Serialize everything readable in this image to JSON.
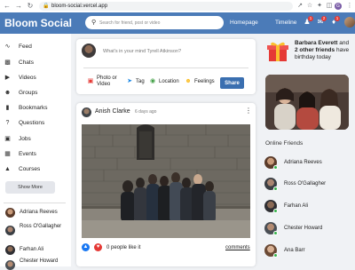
{
  "browser": {
    "url": "bloom-social.vercel.app",
    "profile_initial": "G",
    "icons": [
      "back-icon",
      "forward-icon",
      "reload-icon",
      "lock-icon",
      "share-page-icon",
      "bookmark-star-icon",
      "extensions-icon",
      "side-panel-icon",
      "browser-profile-icon",
      "browser-menu-icon"
    ]
  },
  "header": {
    "brand": "Bloom Social",
    "search_placeholder": "Search for friend, post or video",
    "nav_links": [
      "Homepage",
      "Timeline"
    ],
    "notifications": [
      {
        "icon": "person-icon",
        "count": "1"
      },
      {
        "icon": "chat-icon",
        "count": "2"
      },
      {
        "icon": "bell-icon",
        "count": "1"
      }
    ],
    "color": "#4b7bb8"
  },
  "sidebar": {
    "items": [
      {
        "icon": "rss-feed-icon",
        "label": "Feed"
      },
      {
        "icon": "chat-icon",
        "label": "Chats"
      },
      {
        "icon": "play-circle-icon",
        "label": "Videos"
      },
      {
        "icon": "group-icon",
        "label": "Groups"
      },
      {
        "icon": "bookmark-icon",
        "label": "Bookmarks"
      },
      {
        "icon": "help-circle-icon",
        "label": "Questions"
      },
      {
        "icon": "work-icon",
        "label": "Jobs"
      },
      {
        "icon": "event-icon",
        "label": "Events"
      },
      {
        "icon": "school-icon",
        "label": "Courses"
      }
    ],
    "show_more": "Show More",
    "friends": [
      {
        "name": "Adriana Reeves"
      },
      {
        "name": "Ross O'Gallagher"
      },
      {
        "name": "Farhan Ali"
      },
      {
        "name": "Chester Howard"
      }
    ]
  },
  "share": {
    "placeholder": "What's in your mind Tyrell Atkinson?",
    "options": [
      {
        "icon": "photo-icon",
        "label": "Photo or Video",
        "color": "#e53935"
      },
      {
        "icon": "label-tag-icon",
        "label": "Tag",
        "color": "#1e88e5"
      },
      {
        "icon": "location-icon",
        "label": "Location",
        "color": "#43a047"
      },
      {
        "icon": "emoji-icon",
        "label": "Feelings",
        "color": "#fbc02d"
      }
    ],
    "button": "Share",
    "button_color": "#3a6fb0"
  },
  "post": {
    "author": "Anish Clarke",
    "time": "6 days ago",
    "likes": "0 people like it",
    "comments": "comments",
    "like_color": "#1877f2",
    "heart_color": "#e53935"
  },
  "right": {
    "birthday": {
      "name1": "Barbara Everett",
      "connector": " and ",
      "name2": "2 other friends",
      "rest": " have birthday today"
    },
    "online_title": "Online Friends",
    "online": [
      {
        "name": "Adriana Reeves"
      },
      {
        "name": "Ross O'Gallagher"
      },
      {
        "name": "Farhan Ali"
      },
      {
        "name": "Chester Howard"
      },
      {
        "name": "Ana Barr"
      }
    ],
    "online_color": "#35b34a"
  }
}
